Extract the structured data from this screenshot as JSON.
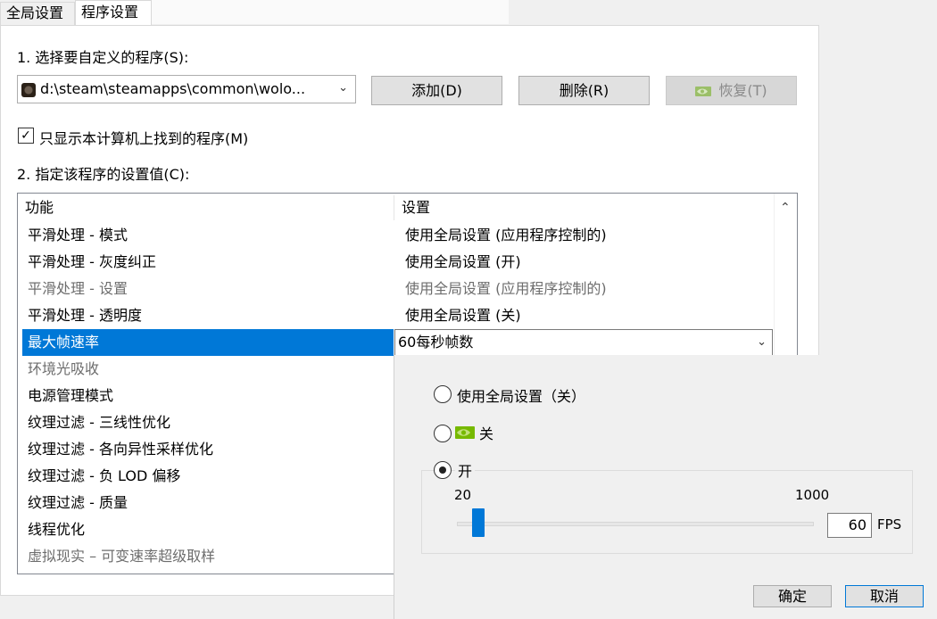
{
  "tabs": [
    {
      "label": "全局设置"
    },
    {
      "label": "程序设置"
    }
  ],
  "section1": {
    "label": "1. 选择要自定义的程序(S):",
    "program": "d:\\steam\\steamapps\\common\\wolo...",
    "add_button": "添加(D)",
    "remove_button": "删除(R)",
    "restore_button": "恢复(T)"
  },
  "filter_checkbox": {
    "label": "只显示本计算机上找到的程序(M)",
    "checked": true
  },
  "section2": {
    "label": "2. 指定该程序的设置值(C):"
  },
  "table": {
    "headers": [
      "功能",
      "设置"
    ],
    "rows": [
      {
        "feature": "平滑处理 - 模式",
        "setting": "使用全局设置 (应用程序控制的)",
        "state": "normal"
      },
      {
        "feature": "平滑处理 - 灰度纠正",
        "setting": "使用全局设置 (开)",
        "state": "normal"
      },
      {
        "feature": "平滑处理 - 设置",
        "setting": "使用全局设置 (应用程序控制的)",
        "state": "dim"
      },
      {
        "feature": "平滑处理 - 透明度",
        "setting": "使用全局设置 (关)",
        "state": "normal"
      },
      {
        "feature": "最大帧速率",
        "setting": "60每秒帧数",
        "state": "selected"
      },
      {
        "feature": "环境光吸收",
        "setting": "",
        "state": "dim"
      },
      {
        "feature": "电源管理模式",
        "setting": "",
        "state": "normal"
      },
      {
        "feature": "纹理过滤 - 三线性优化",
        "setting": "",
        "state": "normal"
      },
      {
        "feature": "纹理过滤 - 各向异性采样优化",
        "setting": "",
        "state": "normal"
      },
      {
        "feature": "纹理过滤 - 负 LOD 偏移",
        "setting": "",
        "state": "normal"
      },
      {
        "feature": "纹理过滤 - 质量",
        "setting": "",
        "state": "normal"
      },
      {
        "feature": "线程优化",
        "setting": "",
        "state": "normal"
      },
      {
        "feature": "虚拟现实 – 可变速率超级取样",
        "setting": "",
        "state": "dim"
      }
    ]
  },
  "popup": {
    "option_global": "使用全局设置（关）",
    "option_off": "关",
    "option_on": "开",
    "selected": "on",
    "slider_min": "20",
    "slider_max": "1000",
    "slider_value": 60,
    "value_text": "60",
    "unit": "FPS",
    "ok_button": "确定",
    "cancel_button": "取消"
  },
  "colors": {
    "selection": "#0078d7",
    "nvidia_green": "#76b900"
  }
}
